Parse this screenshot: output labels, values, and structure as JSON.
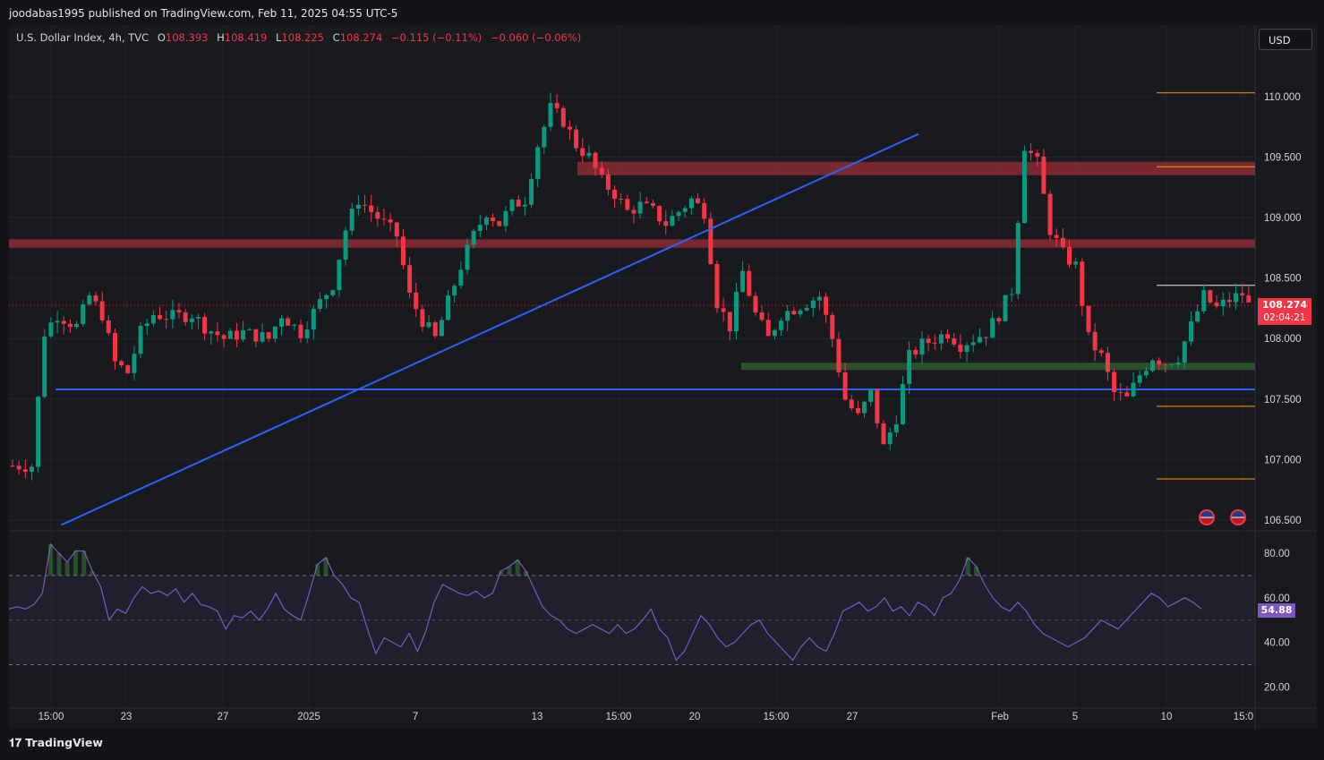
{
  "header": {
    "published": "joodabas1995 published on TradingView.com, Feb 11, 2025 04:55 UTC-5"
  },
  "legend": {
    "symbol": "U.S. Dollar Index, 4h, TVC",
    "open": "108.393",
    "high": "108.419",
    "low": "108.225",
    "close": "108.274",
    "change": "−0.115 (−0.11%)",
    "change2": "−0.060 (−0.06%)"
  },
  "currency_button": "USD",
  "price_tag": {
    "price": "108.274",
    "countdown": "02:04:21"
  },
  "rsi_tag": "54.88",
  "footer": {
    "brand": "TradingView"
  },
  "colors": {
    "up": "#089981",
    "down": "#f23645",
    "trendline": "#2962ff",
    "rsi": "#7e57c2",
    "resistance_zone": "#8b2c33",
    "support_zone": "#2e5c2e",
    "orange_level": "#ff9800"
  },
  "chart_data": [
    {
      "type": "candlestick",
      "title": "U.S. Dollar Index, 4h, TVC",
      "ylim": [
        106.4,
        110.4
      ],
      "y_ticks": [
        "110.000",
        "109.500",
        "109.000",
        "108.500",
        "108.000",
        "107.500",
        "107.000",
        "106.500"
      ],
      "x_ticks": [
        "15:00",
        "23",
        "27",
        "2025",
        "7",
        "13",
        "15:00",
        "20",
        "15:00",
        "27",
        "Feb",
        "5",
        "10",
        "15:0"
      ],
      "last_price": 108.274,
      "close_path": [
        [
          0,
          106.95
        ],
        [
          3,
          106.95
        ],
        [
          5,
          108.05
        ],
        [
          7,
          108.2
        ],
        [
          10,
          108.1
        ],
        [
          12,
          108.35
        ],
        [
          14,
          108.2
        ],
        [
          16,
          107.8
        ],
        [
          18,
          107.72
        ],
        [
          20,
          108.05
        ],
        [
          22,
          108.2
        ],
        [
          25,
          108.18
        ],
        [
          28,
          108.2
        ],
        [
          30,
          108.1
        ],
        [
          33,
          108.0
        ],
        [
          36,
          108.05
        ],
        [
          40,
          108.0
        ],
        [
          42,
          108.2
        ],
        [
          45,
          108.05
        ],
        [
          48,
          108.3
        ],
        [
          50,
          108.45
        ],
        [
          52,
          108.9
        ],
        [
          54,
          109.15
        ],
        [
          56,
          109.05
        ],
        [
          58,
          108.95
        ],
        [
          60,
          108.85
        ],
        [
          62,
          108.35
        ],
        [
          64,
          108.15
        ],
        [
          66,
          108.0
        ],
        [
          68,
          108.3
        ],
        [
          70,
          108.6
        ],
        [
          72,
          108.85
        ],
        [
          74,
          109.05
        ],
        [
          76,
          108.95
        ],
        [
          78,
          109.1
        ],
        [
          80,
          109.15
        ],
        [
          82,
          109.6
        ],
        [
          84,
          109.9
        ],
        [
          86,
          109.8
        ],
        [
          88,
          109.6
        ],
        [
          90,
          109.5
        ],
        [
          92,
          109.3
        ],
        [
          94,
          109.2
        ],
        [
          96,
          109.05
        ],
        [
          98,
          109.1
        ],
        [
          100,
          109.05
        ],
        [
          102,
          108.95
        ],
        [
          104,
          109.05
        ],
        [
          106,
          109.15
        ],
        [
          108,
          109.05
        ],
        [
          110,
          108.3
        ],
        [
          112,
          108.1
        ],
        [
          114,
          108.55
        ],
        [
          116,
          108.2
        ],
        [
          118,
          108.0
        ],
        [
          120,
          108.2
        ],
        [
          122,
          108.25
        ],
        [
          124,
          108.3
        ],
        [
          126,
          108.35
        ],
        [
          128,
          108.0
        ],
        [
          130,
          107.5
        ],
        [
          132,
          107.35
        ],
        [
          134,
          107.55
        ],
        [
          136,
          107.1
        ],
        [
          138,
          107.35
        ],
        [
          140,
          107.85
        ],
        [
          142,
          107.95
        ],
        [
          144,
          108.0
        ],
        [
          146,
          108.05
        ],
        [
          148,
          107.95
        ],
        [
          150,
          108.0
        ],
        [
          152,
          108.05
        ],
        [
          154,
          108.2
        ],
        [
          156,
          108.4
        ],
        [
          158,
          109.6
        ],
        [
          160,
          109.45
        ],
        [
          162,
          108.9
        ],
        [
          164,
          108.7
        ],
        [
          166,
          108.6
        ],
        [
          168,
          108.0
        ],
        [
          170,
          107.85
        ],
        [
          172,
          107.55
        ],
        [
          174,
          107.5
        ],
        [
          176,
          107.7
        ],
        [
          178,
          107.85
        ],
        [
          180,
          107.8
        ],
        [
          182,
          107.85
        ],
        [
          184,
          108.1
        ],
        [
          186,
          108.35
        ],
        [
          188,
          108.25
        ],
        [
          190,
          108.32
        ],
        [
          192,
          108.37
        ],
        [
          193,
          108.274
        ]
      ],
      "horizontal_levels": [
        {
          "name": "support-line",
          "price": 107.58,
          "color": "#2962ff"
        },
        {
          "name": "support-zone",
          "price_low": 107.74,
          "price_high": 107.8,
          "color": "#2e5c2e"
        },
        {
          "name": "resistance-zone-1",
          "price_low": 108.75,
          "price_high": 108.82,
          "color": "#8b2c33"
        },
        {
          "name": "resistance-zone-2",
          "price_low": 109.35,
          "price_high": 109.46,
          "color": "#8b2c33"
        }
      ],
      "orange_levels": [
        110.03,
        109.42,
        107.44,
        106.84
      ],
      "recent_high_level": 108.44,
      "trendline": {
        "from": [
          2,
          106.46
        ],
        "to": [
          125,
          109.69
        ],
        "color": "#2962ff"
      }
    },
    {
      "type": "line",
      "title": "RSI",
      "ylim": [
        15,
        86
      ],
      "y_ticks": [
        "80.00",
        "60.00",
        "40.00",
        "20.00"
      ],
      "bands": [
        30,
        70
      ],
      "mid": 50,
      "last_value": 54.88,
      "values": [
        55,
        56,
        55,
        57,
        62,
        84,
        80,
        76,
        81,
        81,
        72,
        65,
        50,
        55,
        53,
        60,
        65,
        62,
        63,
        61,
        64,
        58,
        62,
        57,
        56,
        54,
        46,
        52,
        51,
        54,
        50,
        55,
        62,
        55,
        52,
        50,
        62,
        75,
        78,
        70,
        66,
        60,
        58,
        46,
        35,
        42,
        40,
        38,
        44,
        36,
        45,
        58,
        66,
        64,
        62,
        61,
        63,
        60,
        62,
        72,
        74,
        77,
        72,
        64,
        56,
        52,
        50,
        46,
        44,
        46,
        48,
        46,
        44,
        48,
        44,
        46,
        50,
        55,
        46,
        42,
        32,
        36,
        44,
        52,
        48,
        42,
        38,
        40,
        44,
        48,
        50,
        44,
        40,
        36,
        32,
        38,
        42,
        38,
        36,
        44,
        54,
        56,
        58,
        54,
        56,
        60,
        54,
        56,
        52,
        58,
        56,
        52,
        60,
        62,
        68,
        78,
        74,
        66,
        60,
        56,
        54,
        58,
        54,
        48,
        44,
        42,
        40,
        38,
        40,
        42,
        46,
        50,
        48,
        46,
        50,
        54,
        58,
        62,
        60,
        56,
        58,
        60,
        58,
        55
      ]
    }
  ]
}
